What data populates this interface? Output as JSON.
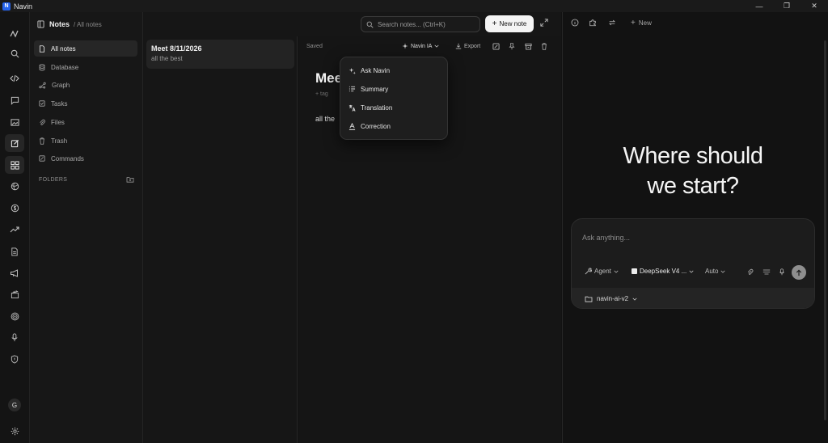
{
  "app": {
    "title": "Navin",
    "logo_letter": "N"
  },
  "window": {
    "minimize": "—",
    "maximize": "❐",
    "close": "✕"
  },
  "rail": {
    "avatar": "G",
    "items": [
      "logo-icon",
      "search-icon",
      "code-icon",
      "chat-icon",
      "image-icon",
      "notes-icon",
      "grid-icon",
      "globe-icon",
      "dollar-icon",
      "trending-icon",
      "document-icon",
      "megaphone-icon",
      "clapperboard-icon",
      "target-icon",
      "microphone-icon",
      "shield-icon",
      "settings-icon"
    ]
  },
  "notes_sidebar": {
    "title": "Notes",
    "breadcrumb": "/ All notes",
    "items": [
      {
        "label": "All notes",
        "icon": "file-icon"
      },
      {
        "label": "Database",
        "icon": "database-icon"
      },
      {
        "label": "Graph",
        "icon": "graph-icon"
      },
      {
        "label": "Tasks",
        "icon": "checkbox-icon"
      },
      {
        "label": "Files",
        "icon": "paperclip-icon"
      },
      {
        "label": "Trash",
        "icon": "trash-icon"
      },
      {
        "label": "Commands",
        "icon": "command-icon"
      }
    ],
    "folders_label": "FOLDERS"
  },
  "header": {
    "search_placeholder": "Search notes... (Ctrl+K)",
    "new_note_label": "New note"
  },
  "note_list": [
    {
      "title": "Meet 8/11/2026",
      "snippet": "all the best"
    }
  ],
  "editor": {
    "status": "Saved",
    "ai_button": "Navin IA",
    "export_label": "Export",
    "title": "Mee",
    "tag_placeholder": "+ tag",
    "body": "all the"
  },
  "ai_menu": {
    "items": [
      {
        "label": "Ask Navin",
        "icon": "sparkles-icon"
      },
      {
        "label": "Summary",
        "icon": "list-icon"
      },
      {
        "label": "Translation",
        "icon": "translate-icon"
      },
      {
        "label": "Correction",
        "icon": "spellcheck-icon"
      }
    ]
  },
  "assistant": {
    "new_label": "New",
    "headline_line1": "Where should",
    "headline_line2": "we start?",
    "input_placeholder": "Ask anything...",
    "agent_label": "Agent",
    "model_label": "DeepSeek V4 ...",
    "mode_label": "Auto",
    "workspace_label": "navin-ai-v2"
  }
}
